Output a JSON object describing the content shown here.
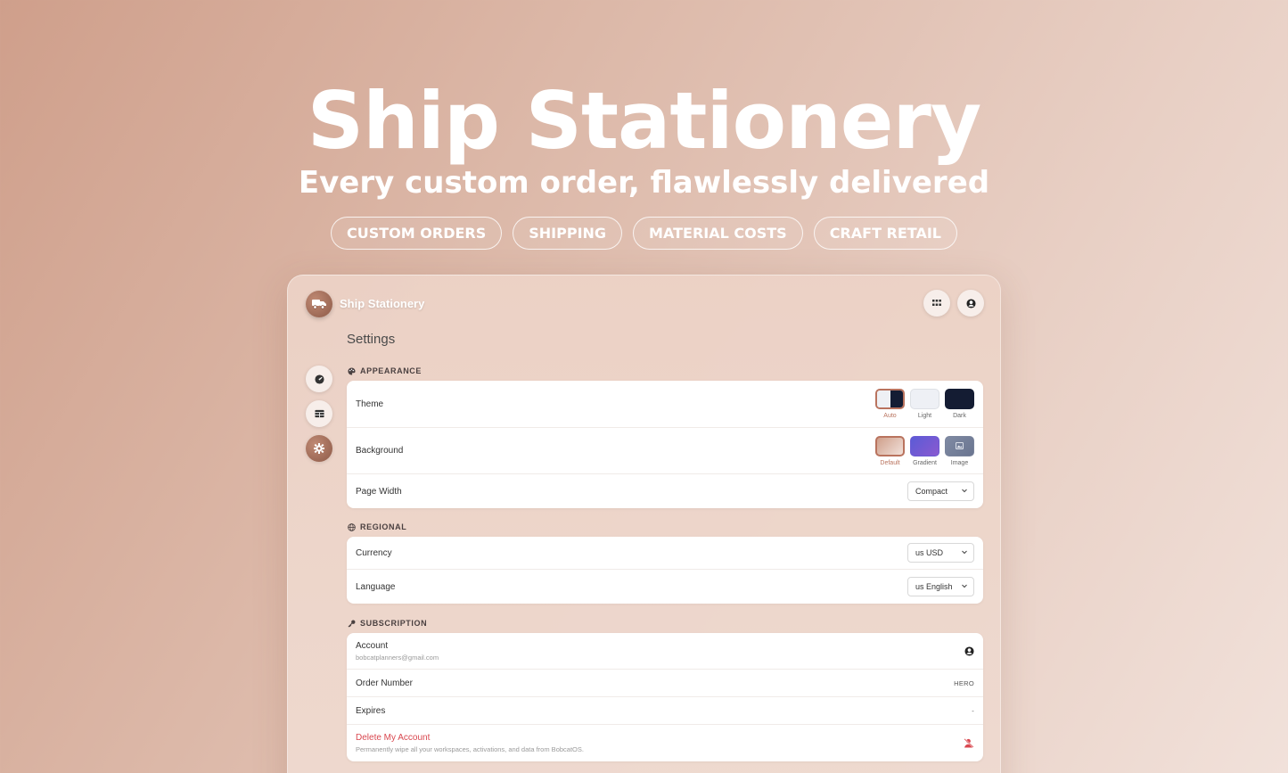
{
  "hero": {
    "title": "Ship Stationery",
    "subtitle": "Every custom order, flawlessly delivered",
    "pills": [
      "CUSTOM ORDERS",
      "SHIPPING",
      "MATERIAL COSTS",
      "CRAFT RETAIL"
    ]
  },
  "app": {
    "name": "Ship Stationery",
    "logo_icon": "truck-icon",
    "top_actions": [
      "apps-grid-icon",
      "account-circle-icon"
    ]
  },
  "sidebar": {
    "items": [
      {
        "icon": "dashboard-gauge-icon",
        "active": false
      },
      {
        "icon": "table-icon",
        "active": false
      },
      {
        "icon": "gear-icon",
        "active": true
      }
    ]
  },
  "settings": {
    "title": "Settings",
    "appearance": {
      "label": "APPEARANCE",
      "theme": {
        "label": "Theme",
        "options": [
          {
            "name": "Auto",
            "selected": true
          },
          {
            "name": "Light",
            "selected": false
          },
          {
            "name": "Dark",
            "selected": false
          }
        ]
      },
      "background": {
        "label": "Background",
        "options": [
          {
            "name": "Default",
            "selected": true
          },
          {
            "name": "Gradient",
            "selected": false
          },
          {
            "name": "Image",
            "selected": false
          }
        ]
      },
      "page_width": {
        "label": "Page Width",
        "value": "Compact"
      }
    },
    "regional": {
      "label": "REGIONAL",
      "currency": {
        "label": "Currency",
        "value": "us USD"
      },
      "language": {
        "label": "Language",
        "value": "us English"
      }
    },
    "subscription": {
      "label": "SUBSCRIPTION",
      "account": {
        "label": "Account",
        "email": "bobcatplanners@gmail.com"
      },
      "order_number": {
        "label": "Order Number",
        "value": "HERO"
      },
      "expires": {
        "label": "Expires",
        "value": "-"
      },
      "delete": {
        "label": "Delete My Account",
        "description": "Permanently wipe all your workspaces, activations, and data from BobcatOS."
      }
    }
  },
  "colors": {
    "accent": "#b9735e",
    "danger": "#d9474f",
    "dark_swatch": "#141c33",
    "gradient_swatch_start": "#5b5bd6",
    "gradient_swatch_end": "#8a5ad0"
  }
}
